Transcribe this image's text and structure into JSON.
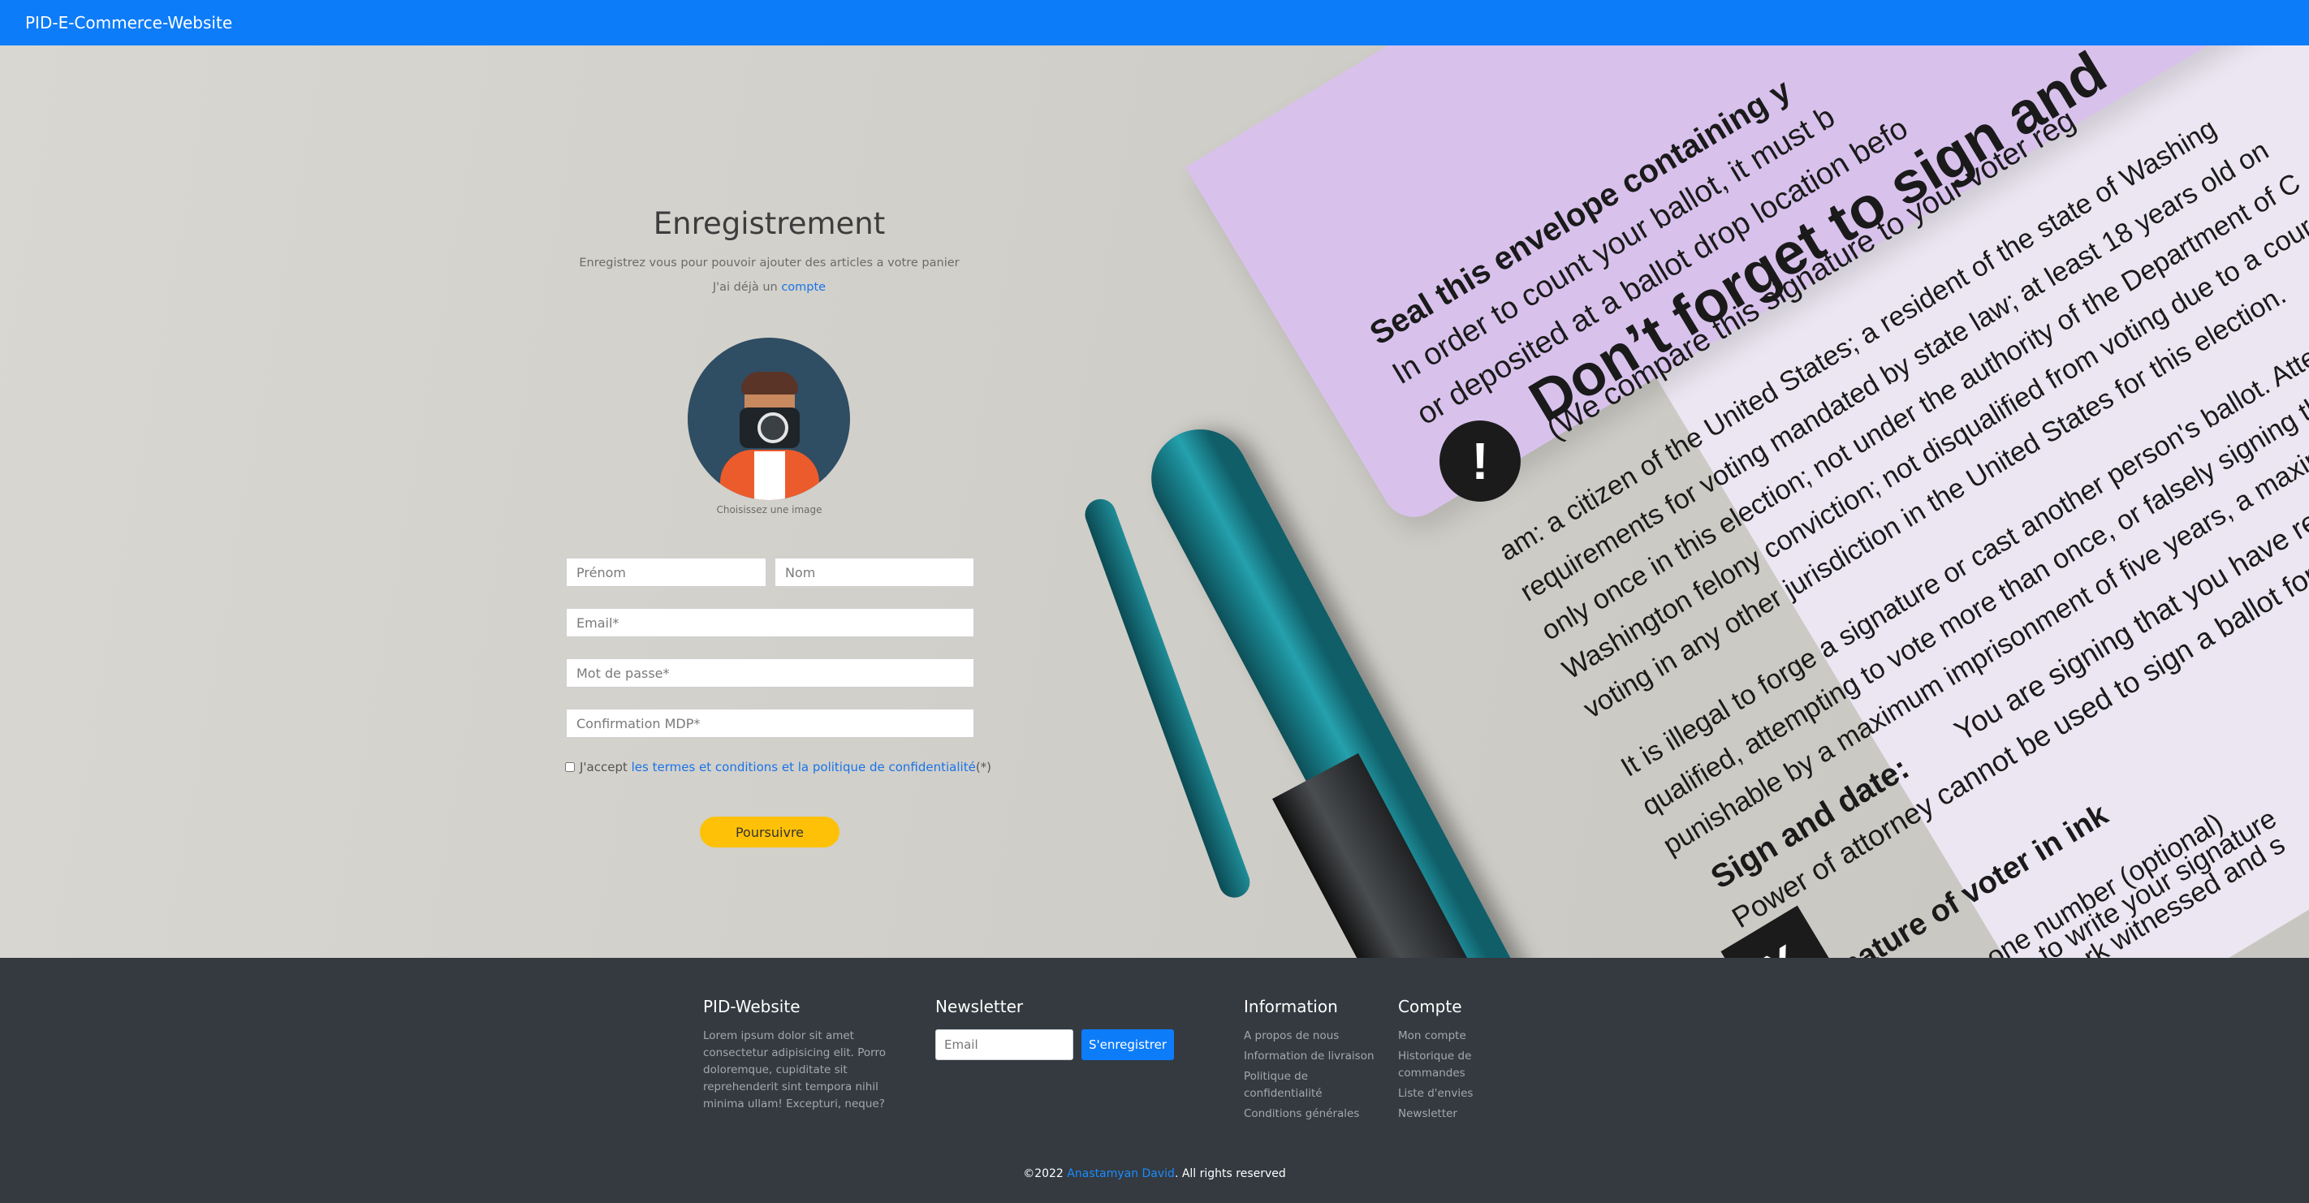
{
  "navbar": {
    "brand": "PID-E-Commerce-Website"
  },
  "form": {
    "title": "Enregistrement",
    "subtitle": "Enregistrez vous pour pouvoir ajouter des articles a votre panier",
    "login_prefix": "J'ai déjà un ",
    "login_link": "compte",
    "avatar_caption": "Choisissez une image",
    "firstname_placeholder": "Prénom",
    "lastname_placeholder": "Nom",
    "email_placeholder": "Email*",
    "password_placeholder": "Mot de passe*",
    "confirm_placeholder": "Confirmation MDP*",
    "terms_prefix": "J'accept ",
    "terms_link": "les termes et conditions et la politique de confidentialité",
    "terms_suffix": "(*)",
    "submit_label": "Poursuivre"
  },
  "background_photo": {
    "lines": [
      "Seal this envelope containing y",
      "In order to count your ballot, it must b",
      "or deposited at a ballot drop location befo",
      "Don’t forget to sign and",
      "(We compare this signature to your voter reg",
      "am: a citizen of the United States; a resident of the state of Washing",
      "requirements for voting mandated by state law; at least 18 years old on",
      "only once in this election; not under the authority of the Department of C",
      "Washington felony conviction; not disqualified from voting due to a cour",
      "voting in any other jurisdiction in the United States for this election.",
      "It is illegal to forge a signature or cast another person's ballot. Atte",
      "qualified, attempting to vote more than once, or falsely signing th",
      "punishable by a maximum imprisonment of five years, a maxim",
      "Sign and date:",
      "You are signing that you have read the d",
      "Power of attorney cannot be used to sign a ballot for so",
      "nature of voter in ink",
      "one number (optional)",
      "e to write your signature",
      "rk witnessed and s"
    ],
    "warning_glyph": "!",
    "x_glyph": "X"
  },
  "footer": {
    "about": {
      "heading": "PID-Website",
      "text": "Lorem ipsum dolor sit amet consectetur adipisicing elit. Porro doloremque, cupiditate sit reprehenderit sint tempora nihil minima ullam! Excepturi, neque?"
    },
    "newsletter": {
      "heading": "Newsletter",
      "email_placeholder": "Email",
      "button_label": "S'enregistrer"
    },
    "information": {
      "heading": "Information",
      "links": [
        "A propos de nous",
        "Information de livraison",
        "Politique de confidentialité",
        "Conditions générales"
      ]
    },
    "account": {
      "heading": "Compte",
      "links": [
        "Mon compte",
        "Historique de commandes",
        "Liste d'envies",
        "Newsletter"
      ]
    },
    "copyright_prefix": "©2022 ",
    "copyright_author": "Anastamyan David",
    "copyright_suffix": ". All rights reserved"
  },
  "colors": {
    "navbar": "#0d7cf9",
    "submit_button": "#ffc107",
    "link": "#1a73e8",
    "footer": "#343a40"
  }
}
